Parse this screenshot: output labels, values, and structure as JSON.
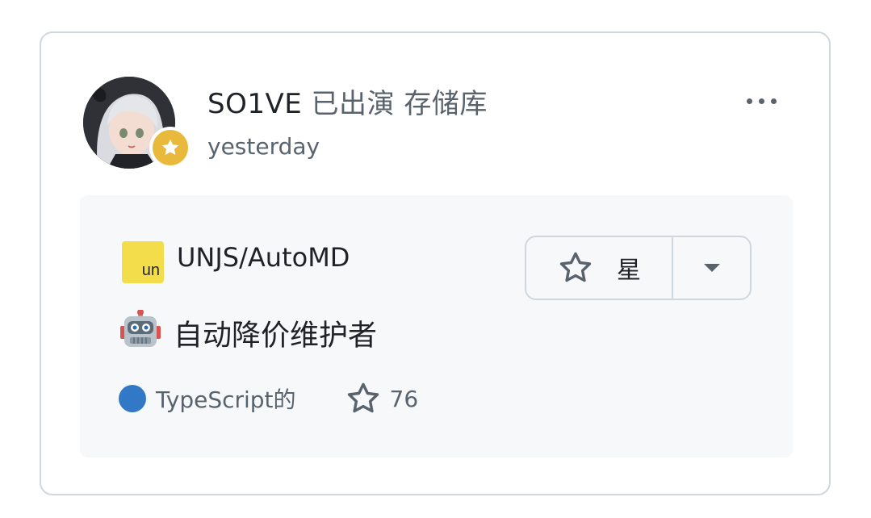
{
  "event": {
    "actor": "SO1VE",
    "action": "已出演 存储库",
    "time": "yesterday",
    "more_icon": "kebab-horizontal-icon"
  },
  "avatar": {
    "badge_icon": "star-badge-icon",
    "badge_color": "#e9b93c"
  },
  "repo": {
    "org_logo_text": "un",
    "org_logo_color": "#f4dd4a",
    "name": "UNJS/AutoMD",
    "description_emoji": "robot-icon",
    "description": "自动降价维护者",
    "language": "TypeScript的",
    "language_color": "#3178c6",
    "stars": "76"
  },
  "star_button": {
    "label": "星",
    "icon": "star-outline-icon",
    "dropdown_icon": "triangle-down-icon"
  }
}
